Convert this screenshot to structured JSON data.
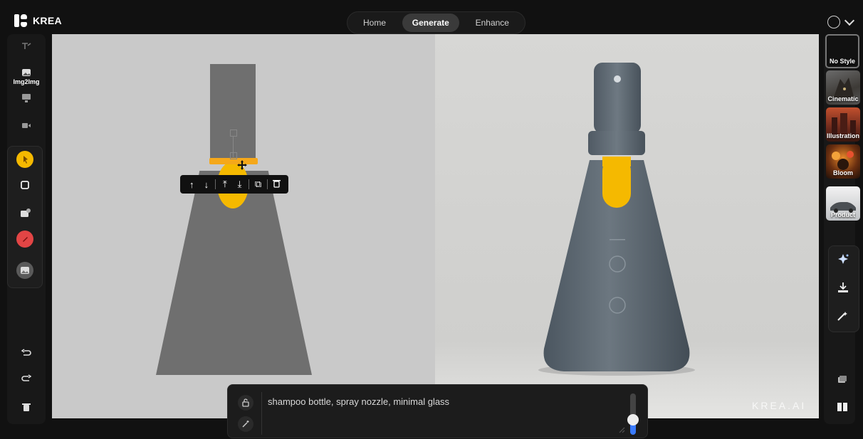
{
  "app": {
    "brand": "KREA"
  },
  "nav": {
    "tabs": [
      {
        "label": "Home"
      },
      {
        "label": "Generate"
      },
      {
        "label": "Enhance"
      }
    ],
    "active": "Generate"
  },
  "left_rail": {
    "img2img_label": "Img2Img"
  },
  "context_toolbar": {
    "buttons": [
      {
        "name": "move-up",
        "glyph": "↑"
      },
      {
        "name": "move-down",
        "glyph": "↓"
      },
      {
        "name": "bring-to-front",
        "glyph": "⤒"
      },
      {
        "name": "send-to-back",
        "glyph": "⤓"
      },
      {
        "name": "duplicate",
        "glyph": "⧉"
      },
      {
        "name": "delete",
        "glyph": "🗑"
      }
    ]
  },
  "styles": [
    {
      "label": "No Style"
    },
    {
      "label": "Cinematic"
    },
    {
      "label": "Illustration"
    },
    {
      "label": "Bloom"
    },
    {
      "label": "Product"
    }
  ],
  "prompt": {
    "text": "shampoo bottle, spray nozzle, minimal glass",
    "strength": 0.3
  },
  "watermark": "KREA.AI",
  "colors": {
    "accent_yellow": "#f5b900",
    "shape_gray": "#6f6f6f",
    "canvas_left": "#c9c9c9",
    "pen_red": "#e24545",
    "slider_blue": "#3a7bff"
  }
}
